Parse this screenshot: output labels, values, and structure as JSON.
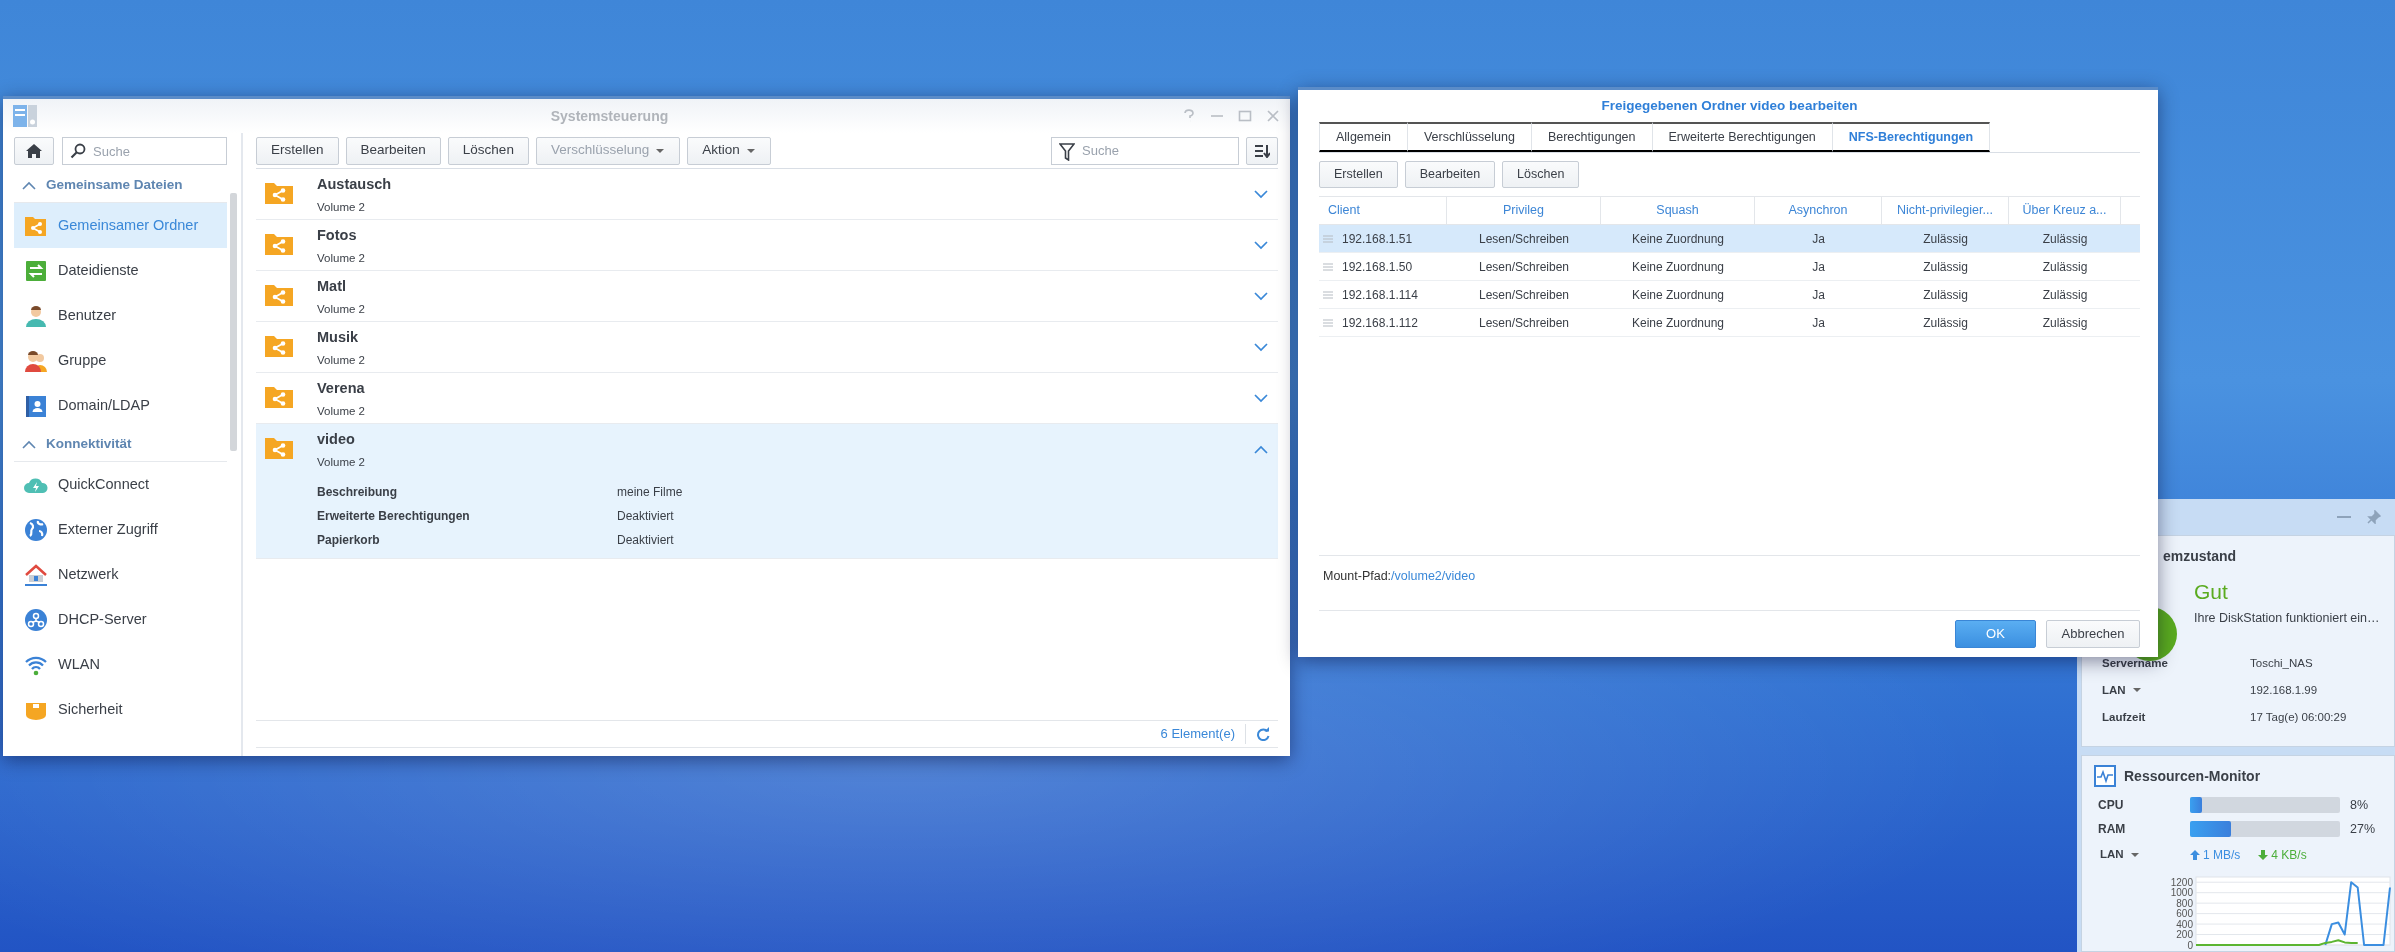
{
  "control_panel": {
    "title": "Systemsteuerung",
    "search_placeholder": "Suche",
    "sidebar": [
      {
        "label": "Gemeinsame Dateien",
        "expanded": true,
        "items": [
          {
            "label": "Gemeinsamer Ordner",
            "selected": true
          },
          {
            "label": "Dateidienste",
            "selected": false
          },
          {
            "label": "Benutzer",
            "selected": false
          },
          {
            "label": "Gruppe",
            "selected": false
          },
          {
            "label": "Domain/LDAP",
            "selected": false
          }
        ]
      },
      {
        "label": "Konnektivität",
        "expanded": true,
        "items": [
          {
            "label": "QuickConnect",
            "selected": false
          },
          {
            "label": "Externer Zugriff",
            "selected": false
          },
          {
            "label": "Netzwerk",
            "selected": false
          },
          {
            "label": "DHCP-Server",
            "selected": false
          },
          {
            "label": "WLAN",
            "selected": false
          },
          {
            "label": "Sicherheit",
            "selected": false
          }
        ]
      }
    ],
    "toolbar": [
      {
        "label": "Erstellen",
        "disabled": false,
        "dropdown": false
      },
      {
        "label": "Bearbeiten",
        "disabled": false,
        "dropdown": false
      },
      {
        "label": "Löschen",
        "disabled": false,
        "dropdown": false
      },
      {
        "label": "Verschlüsselung",
        "disabled": true,
        "dropdown": true
      },
      {
        "label": "Aktion",
        "disabled": false,
        "dropdown": true
      }
    ],
    "filter_placeholder": "Suche",
    "folders": [
      {
        "name": "Austausch",
        "volume": "Volume 2",
        "expanded": false
      },
      {
        "name": "Fotos",
        "volume": "Volume 2",
        "expanded": false
      },
      {
        "name": "Matl",
        "volume": "Volume 2",
        "expanded": false
      },
      {
        "name": "Musik",
        "volume": "Volume 2",
        "expanded": false
      },
      {
        "name": "Verena",
        "volume": "Volume 2",
        "expanded": false
      },
      {
        "name": "video",
        "volume": "Volume 2",
        "expanded": true,
        "details": [
          {
            "label": "Beschreibung",
            "value": "meine Filme"
          },
          {
            "label": "Erweiterte Berechtigungen",
            "value": "Deaktiviert"
          },
          {
            "label": "Papierkorb",
            "value": "Deaktiviert"
          }
        ]
      }
    ],
    "count": "6 Element(e)"
  },
  "dialog": {
    "title": "Freigegebenen Ordner video bearbeiten",
    "tabs": [
      {
        "label": "Allgemein",
        "selected": false
      },
      {
        "label": "Verschlüsselung",
        "selected": false
      },
      {
        "label": "Berechtigungen",
        "selected": false
      },
      {
        "label": "Erweiterte Berechtigungen",
        "selected": false
      },
      {
        "label": "NFS-Berechtigungen",
        "selected": true
      }
    ],
    "buttons": [
      "Erstellen",
      "Bearbeiten",
      "Löschen"
    ],
    "table": {
      "columns": [
        "Client",
        "Privileg",
        "Squash",
        "Asynchron",
        "Nicht-privilegier...",
        "Über Kreuz a..."
      ],
      "rows": [
        {
          "selected": true,
          "cells": [
            "192.168.1.51",
            "Lesen/Schreiben",
            "Keine Zuordnung",
            "Ja",
            "Zulässig",
            "Zulässig"
          ]
        },
        {
          "selected": false,
          "cells": [
            "192.168.1.50",
            "Lesen/Schreiben",
            "Keine Zuordnung",
            "Ja",
            "Zulässig",
            "Zulässig"
          ]
        },
        {
          "selected": false,
          "cells": [
            "192.168.1.114",
            "Lesen/Schreiben",
            "Keine Zuordnung",
            "Ja",
            "Zulässig",
            "Zulässig"
          ]
        },
        {
          "selected": false,
          "cells": [
            "192.168.1.112",
            "Lesen/Schreiben",
            "Keine Zuordnung",
            "Ja",
            "Zulässig",
            "Zulässig"
          ]
        }
      ]
    },
    "mount_path_label": "Mount-Pfad:",
    "mount_path": "/volume2/video",
    "ok": "OK",
    "cancel": "Abbrechen"
  },
  "widget": {
    "status": {
      "title": "emzustand",
      "state": "Gut",
      "message": "Ihre DiskStation funktioniert ein…",
      "rows": [
        {
          "label": "Servername",
          "value": "Toschi_NAS",
          "dropdown": false
        },
        {
          "label": "LAN",
          "value": "192.168.1.99",
          "dropdown": true
        },
        {
          "label": "Laufzeit",
          "value": "17 Tag(e) 06:00:29",
          "dropdown": false
        }
      ]
    },
    "monitor": {
      "title": "Ressourcen-Monitor",
      "meters": [
        {
          "label": "CPU",
          "level": 0.08,
          "reading": "8%"
        },
        {
          "label": "RAM",
          "level": 0.27,
          "reading": "27%"
        }
      ],
      "network": {
        "label": "LAN",
        "dropdown": true,
        "upload": "1 MB/s",
        "download": "4 KB/s"
      },
      "chart_data": {
        "type": "line",
        "ylim": [
          0,
          1300
        ],
        "yticks": [
          0,
          200,
          400,
          600,
          800,
          1000,
          1200
        ],
        "grid": true,
        "series": [
          {
            "color": "#3b8ee0",
            "values": [
              null,
              null,
              null,
              null,
              null,
              null,
              null,
              null,
              null,
              null,
              null,
              null,
              null,
              null,
              null,
              null,
              null,
              null,
              null,
              null,
              0,
              400,
              430,
              200,
              1200,
              1100,
              0,
              0,
              0,
              0,
              1100
            ]
          },
          {
            "color": "#5cb531",
            "values": [
              0,
              0,
              0,
              0,
              0,
              0,
              0,
              0,
              0,
              0,
              0,
              0,
              0,
              0,
              0,
              0,
              0,
              0,
              0,
              0,
              40,
              60,
              90,
              50,
              40,
              40,
              null,
              null,
              null,
              null,
              null
            ]
          }
        ]
      }
    }
  }
}
